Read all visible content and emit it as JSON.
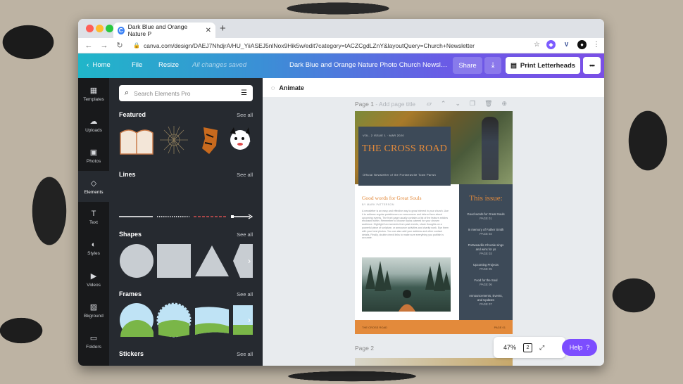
{
  "browser": {
    "tab_title": "Dark Blue and Orange Nature P",
    "tab_favicon": "C",
    "new_tab": "+",
    "url": "canva.com/design/DAEJ7NhdjrA/HU_YiiASEJ5nlNox9Hik5w/edit?category=tACZCgdLZnY&layoutQuery=Church+Newsletter"
  },
  "topbar": {
    "home": "Home",
    "file": "File",
    "resize": "Resize",
    "status": "All changes saved",
    "doc_title": "Dark Blue and Orange Nature Photo Church Newsl…",
    "share": "Share",
    "print": "Print Letterheads"
  },
  "rail": [
    {
      "label": "Templates",
      "icon": "▦"
    },
    {
      "label": "Uploads",
      "icon": "☁"
    },
    {
      "label": "Photos",
      "icon": "▣"
    },
    {
      "label": "Elements",
      "icon": "◇"
    },
    {
      "label": "Text",
      "icon": "T"
    },
    {
      "label": "Styles",
      "icon": "◐"
    },
    {
      "label": "Videos",
      "icon": "▶"
    },
    {
      "label": "Bkground",
      "icon": "▨"
    },
    {
      "label": "Folders",
      "icon": "▭"
    }
  ],
  "panel": {
    "search_placeholder": "Search Elements Pro",
    "see_all": "See all",
    "sections": [
      "Featured",
      "Lines",
      "Shapes",
      "Frames",
      "Stickers"
    ]
  },
  "workspace": {
    "animate": "Animate",
    "page1": "Page 1",
    "page1_sub": "- Add page title",
    "page2": "Page 2",
    "zoom": "47%",
    "pages_count": "2",
    "help": "Help",
    "help_mark": "?"
  },
  "newsletter": {
    "issue_line": "VOL. 2 ISSUE 1  ·  MAR 2020",
    "title": "THE CROSS ROAD",
    "subtitle": "Official Newsletter of the Portweaville Town Parish",
    "article_title": "Good words for Great Souls",
    "byline": "BY MARK PATTERSON",
    "body": "A newsletter is an easy and effective way to grow interest in your church. Use it to address regular parishioners on newcomers and inform them about upcoming events. The front page usually contains a list of the feature articles enclosed within. Remember to choose topics catered for your chosen audience. Highlight fun moments from past events, share thoughts on a powerful piece of scripture, or announce activities and charity work. Eye them with your best photos. You can also add your address and other contact details. Finally, double check links to make sure everything you publish is accurate.",
    "sidebar_title": "This issue:",
    "contents": [
      {
        "title": "Good words for Great Souls",
        "page": "PAGE 01"
      },
      {
        "title": "In memory of Father Smith",
        "page": "PAGE 02"
      },
      {
        "title": "Portweaville Chorale sings and wins for ys",
        "page": "PAGE 03"
      },
      {
        "title": "Upcoming Projects",
        "page": "PAGE 05"
      },
      {
        "title": "Food for the Soul",
        "page": "PAGE 06"
      },
      {
        "title": "Announcements, Events, and Updates",
        "page": "PAGE 07"
      }
    ],
    "footer_left": "THE CROSS ROAD",
    "footer_right": "PAGE 01"
  }
}
